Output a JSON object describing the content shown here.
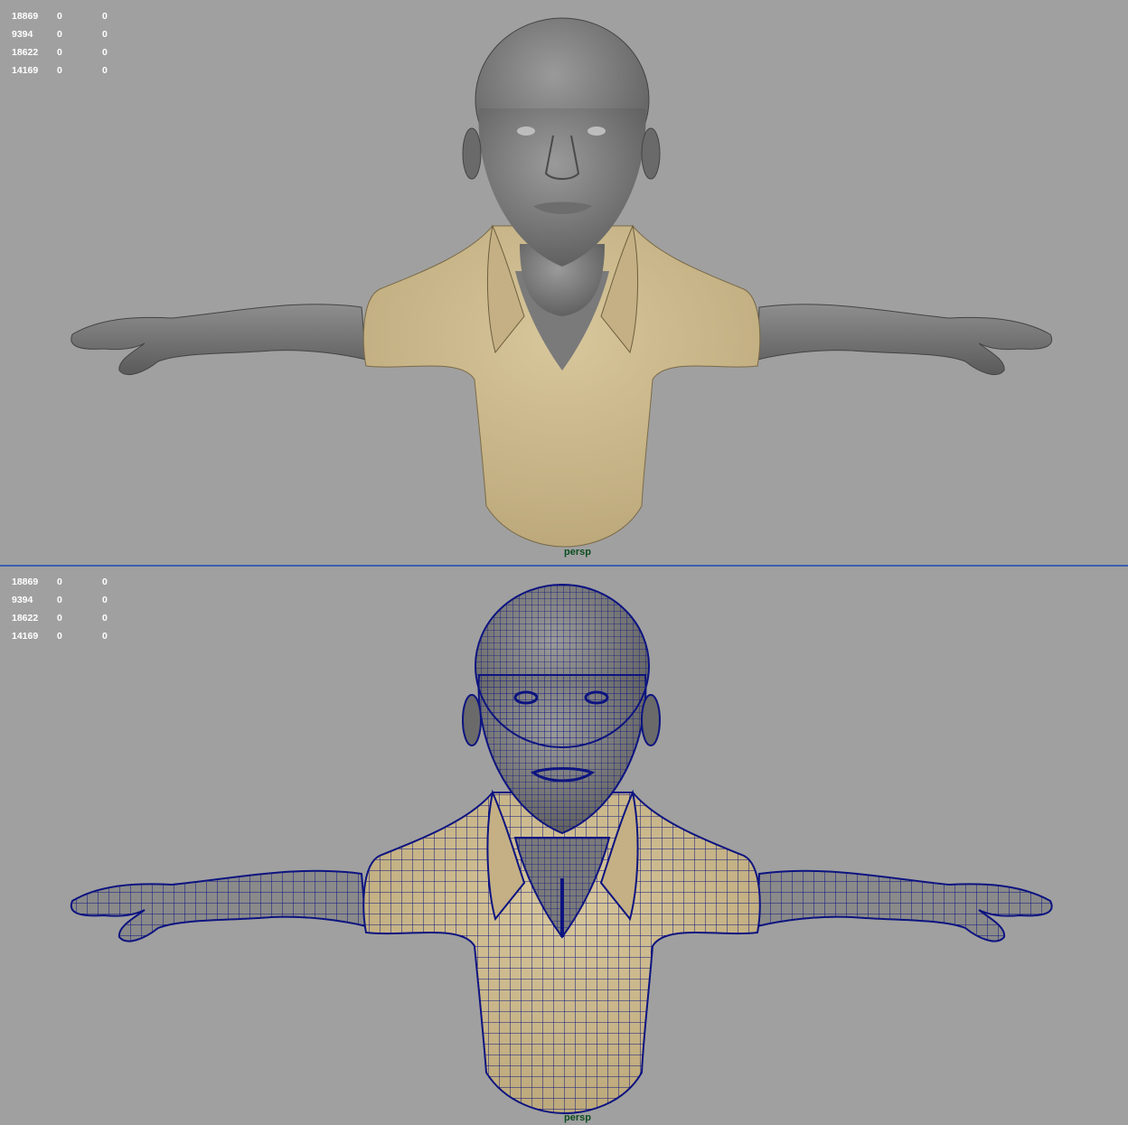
{
  "viewports": [
    {
      "id": "top",
      "shading": "smooth shaded",
      "camera_label": "persp",
      "hud": {
        "partial_row": [
          "",
          ""
        ],
        "rows": [
          [
            "18869",
            "0",
            "0"
          ],
          [
            "9394",
            "0",
            "0"
          ],
          [
            "18622",
            "0",
            "0"
          ],
          [
            "14169",
            "0",
            "0"
          ]
        ]
      }
    },
    {
      "id": "bottom",
      "shading": "wireframe on shaded",
      "camera_label": "persp",
      "hud": {
        "rows": [
          [
            "18869",
            "0",
            "0"
          ],
          [
            "9394",
            "0",
            "0"
          ],
          [
            "18622",
            "0",
            "0"
          ],
          [
            "14169",
            "0",
            "0"
          ]
        ]
      }
    }
  ],
  "colors": {
    "viewport_bg": "#a0a0a0",
    "skin": "#7d7d7d",
    "shirt": "#cfbb8e",
    "wireframe": "#0d1480",
    "divider": "#3a5fb0",
    "camera_label": "#0b4d20"
  }
}
